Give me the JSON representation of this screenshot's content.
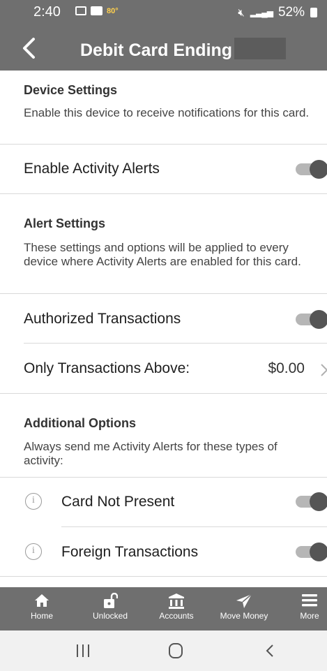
{
  "status_bar": {
    "time": "2:40",
    "temperature": "80°",
    "battery": "52%",
    "icons": [
      "gallery-icon",
      "mail-icon",
      "mute-icon",
      "signal-icon",
      "battery-icon"
    ]
  },
  "header": {
    "title": "Debit Card Ending",
    "back_icon": "chevron-left-icon"
  },
  "device_settings": {
    "heading": "Device Settings",
    "description": "Enable this device to receive notifications for this card.",
    "rows": [
      {
        "label": "Enable Activity Alerts",
        "enabled": true
      }
    ]
  },
  "alert_settings": {
    "heading": "Alert Settings",
    "description": "These settings and options will be applied to every device where Activity Alerts are enabled for this card.",
    "authorized": {
      "label": "Authorized Transactions",
      "enabled": true
    },
    "threshold": {
      "label": "Only Transactions Above:",
      "value": "$0.00"
    }
  },
  "additional_options": {
    "heading": "Additional Options",
    "description": "Always send me Activity Alerts for these types of activity:",
    "rows": [
      {
        "label": "Card Not Present",
        "enabled": true,
        "icon": "info-icon"
      },
      {
        "label": "Foreign Transactions",
        "enabled": true,
        "icon": "info-icon"
      }
    ]
  },
  "bottom_nav": {
    "items": [
      {
        "label": "Home",
        "icon": "home-icon"
      },
      {
        "label": "Unlocked",
        "icon": "unlock-icon"
      },
      {
        "label": "Accounts",
        "icon": "bank-icon"
      },
      {
        "label": "Move Money",
        "icon": "send-icon"
      },
      {
        "label": "More",
        "icon": "menu-icon"
      }
    ]
  },
  "system_nav": {
    "buttons": [
      "recents-icon",
      "home-circle-icon",
      "back-icon"
    ]
  },
  "colors": {
    "header_bg": "#6f6f6f",
    "toggle_track": "#b6b6b6",
    "toggle_knob": "#555555",
    "divider": "#d9d9d9",
    "sysnav_bg": "#f1f1f1"
  }
}
